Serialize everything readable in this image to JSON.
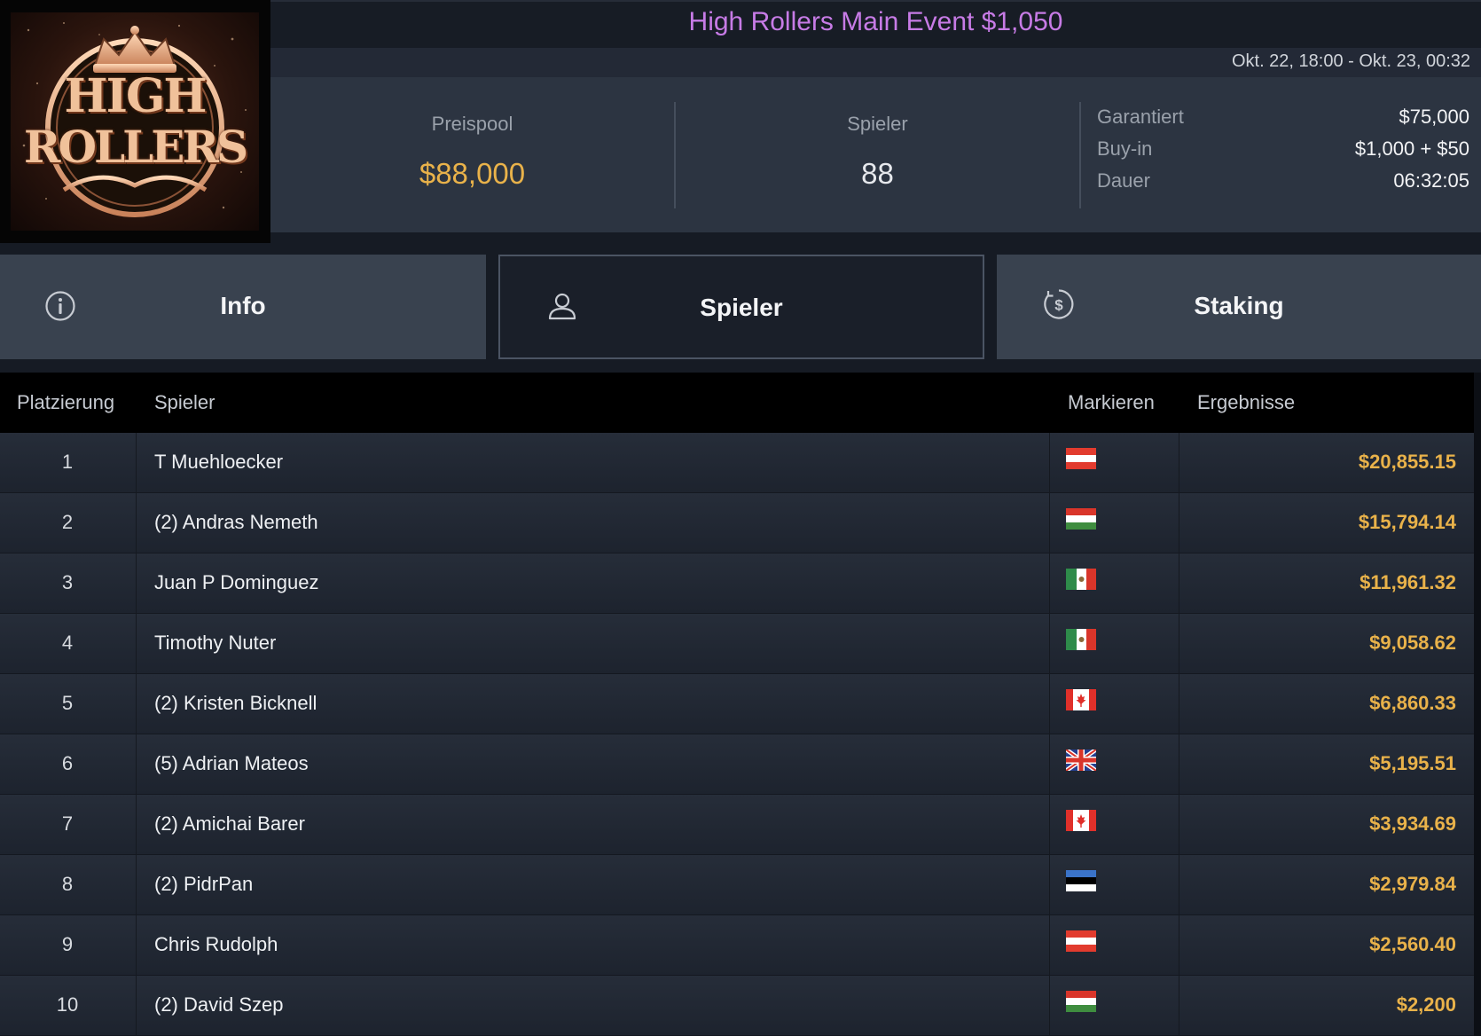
{
  "header": {
    "title": "High Rollers Main Event $1,050",
    "dates": "Okt. 22, 18:00 - Okt. 23, 00:32",
    "logo_text": [
      "HIGH",
      "ROLLERS"
    ]
  },
  "stats": {
    "prize_label": "Preispool",
    "prize_value": "$88,000",
    "players_label": "Spieler",
    "players_value": "88",
    "details": [
      {
        "label": "Garantiert",
        "value": "$75,000"
      },
      {
        "label": "Buy-in",
        "value": "$1,000 + $50"
      },
      {
        "label": "Dauer",
        "value": "06:32:05"
      }
    ]
  },
  "tabs": [
    {
      "label": "Info",
      "icon": "info-icon",
      "active": false
    },
    {
      "label": "Spieler",
      "icon": "user-icon",
      "active": true
    },
    {
      "label": "Staking",
      "icon": "dollar-coin-icon",
      "active": false
    }
  ],
  "table": {
    "columns": {
      "rank": "Platzierung",
      "player": "Spieler",
      "flag": "Markieren",
      "result": "Ergebnisse"
    },
    "rows": [
      {
        "rank": "1",
        "name": "T Muehloecker",
        "flag": "austria",
        "result": "$20,855.15"
      },
      {
        "rank": "2",
        "name": "(2) Andras Nemeth",
        "flag": "hungary",
        "result": "$15,794.14"
      },
      {
        "rank": "3",
        "name": "Juan P Dominguez",
        "flag": "mexico",
        "result": "$11,961.32"
      },
      {
        "rank": "4",
        "name": "Timothy Nuter",
        "flag": "mexico",
        "result": "$9,058.62"
      },
      {
        "rank": "5",
        "name": "(2) Kristen Bicknell",
        "flag": "canada",
        "result": "$6,860.33"
      },
      {
        "rank": "6",
        "name": "(5) Adrian Mateos",
        "flag": "united-kingdom",
        "result": "$5,195.51"
      },
      {
        "rank": "7",
        "name": "(2) Amichai Barer",
        "flag": "canada",
        "result": "$3,934.69"
      },
      {
        "rank": "8",
        "name": "(2) PidrPan",
        "flag": "estonia",
        "result": "$2,979.84"
      },
      {
        "rank": "9",
        "name": "Chris Rudolph",
        "flag": "austria",
        "result": "$2,560.40"
      },
      {
        "rank": "10",
        "name": "(2) David Szep",
        "flag": "hungary",
        "result": "$2,200"
      }
    ]
  },
  "colors": {
    "title": "#c77be6",
    "money": "#e9b24a",
    "background": "#161b24"
  }
}
